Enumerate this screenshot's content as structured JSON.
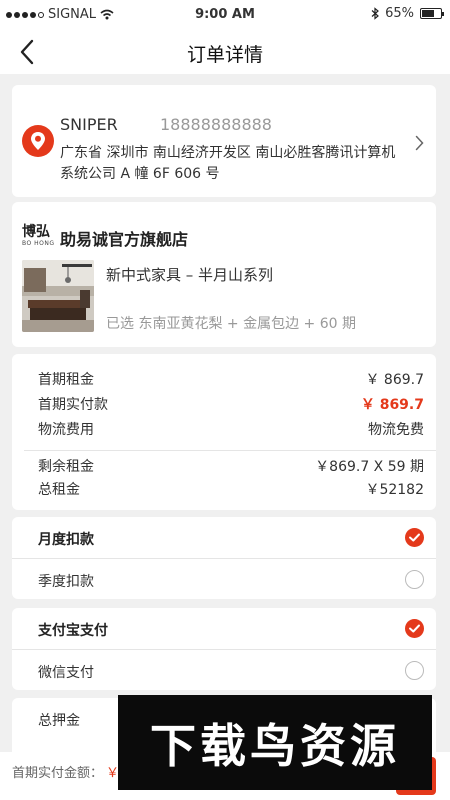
{
  "status_bar": {
    "carrier": "SIGNAL",
    "time": "9:00 AM",
    "battery": "65%",
    "battery_level": 0.65
  },
  "nav": {
    "title": "订单详情"
  },
  "address": {
    "name": "SNIPER",
    "phone": "18888888888",
    "detail": "广东省 深圳市 南山经济开发区 南山必胜客腾讯计算机系统公司 A 幢 6F 606 号"
  },
  "shop": {
    "logo_cn": "博弘",
    "logo_en": "BO HONG",
    "name": "助易诚官方旗舰店",
    "product_name": "新中式家具 – 半月山系列",
    "product_spec": "已选   东南亚黄花梨 + 金属包边 + 60 期"
  },
  "price": {
    "rows": [
      {
        "label": "首期租金",
        "value": "￥ 869.7"
      },
      {
        "label": "首期实付款",
        "value": "￥ 869.7"
      },
      {
        "label": "物流费用",
        "value": "物流免费"
      },
      {
        "label": "剩余租金",
        "value": "￥869.7 X 59 期"
      },
      {
        "label": "总租金",
        "value": "￥52182"
      }
    ]
  },
  "deduction": {
    "options": [
      {
        "label": "月度扣款",
        "checked": true
      },
      {
        "label": "季度扣款",
        "checked": false
      }
    ]
  },
  "payment": {
    "options": [
      {
        "label": "支付宝支付",
        "checked": true
      },
      {
        "label": "微信支付",
        "checked": false
      }
    ]
  },
  "deposit": {
    "label": "总押金"
  },
  "bottom": {
    "label": "首期实付金额：",
    "amount": "￥"
  },
  "watermark": {
    "text": "下载鸟资源"
  },
  "colors": {
    "accent": "#e4391b",
    "background": "#f0f0f0"
  }
}
